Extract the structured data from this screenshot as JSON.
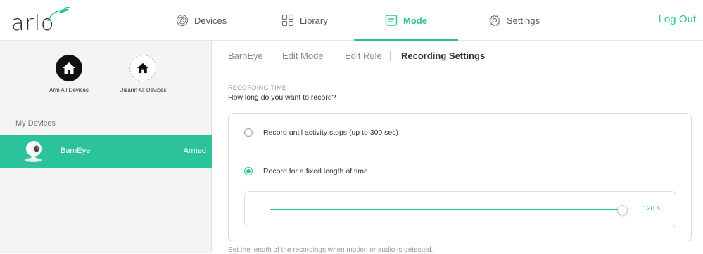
{
  "brand": {
    "logo_text": "arlo",
    "accent": "#2bc39a"
  },
  "nav": {
    "devices": {
      "label": "Devices",
      "icon": "devices-icon"
    },
    "library": {
      "label": "Library",
      "icon": "library-grid-icon"
    },
    "mode": {
      "label": "Mode",
      "icon": "mode-icon",
      "active": true
    },
    "settings": {
      "label": "Settings",
      "icon": "gear-icon"
    },
    "logout": "Log Out"
  },
  "sidebar": {
    "arm_all": {
      "label": "Arm All Devices",
      "icon": "home-icon"
    },
    "disarm_all": {
      "label": "Disarm All Devices",
      "icon": "home-icon"
    },
    "section_title": "My Devices",
    "devices": [
      {
        "name": "BarnEye",
        "status": "Armed",
        "icon": "camera-icon",
        "selected": true
      }
    ]
  },
  "breadcrumb": [
    "BarnEye",
    "Edit Mode",
    "Edit Rule",
    "Recording Settings"
  ],
  "recording": {
    "section_label": "RECORDING TIME",
    "question": "How long do you want to record?",
    "options": [
      {
        "label": "Record until activity stops (up to 300 sec)",
        "selected": false
      },
      {
        "label": "Record for a fixed length of time",
        "selected": true
      }
    ],
    "slider": {
      "value_label": "120 s",
      "fill_fraction": 1.0
    },
    "footnote": "Set the length of the recordings when motion or audio is detected."
  }
}
